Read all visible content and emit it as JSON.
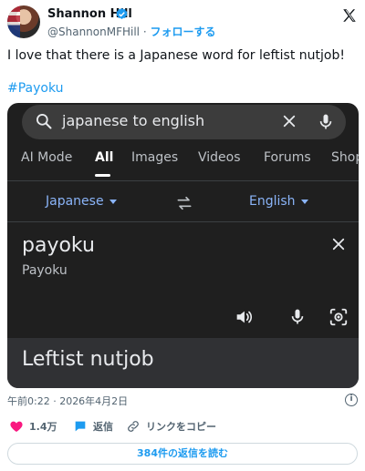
{
  "tweet": {
    "author_name": "Shannon Hill",
    "handle": "@ShannonMFHill",
    "separator": "·",
    "follow_label": "フォローする",
    "text": "I love that there is a Japanese word for leftist nutjob!",
    "hashtag": "#Payoku",
    "timestamp": "午前0:22 · 2026年4月2日",
    "likes_count": "1.4万",
    "reply_label": "返信",
    "copy_link_label": "リンクをコピー",
    "read_replies_label": "384件の返信を読む"
  },
  "media": {
    "search_query": "japanese to english",
    "tabs": [
      {
        "label": "AI Mode"
      },
      {
        "label": "All"
      },
      {
        "label": "Images"
      },
      {
        "label": "Videos"
      },
      {
        "label": "Forums"
      },
      {
        "label": "Shop"
      }
    ],
    "active_tab": "All",
    "source_language": "Japanese",
    "target_language": "English",
    "source_word": "payoku",
    "source_transliteration": "Payoku",
    "translation": "Leftist nutjob"
  },
  "colors": {
    "brand_blue": "#1d9bf0",
    "like_pink": "#f91880",
    "google_dark_bg": "#1f1f1f",
    "google_link_blue": "#8ab4f8"
  },
  "icons": [
    "verified-badge-icon",
    "x-logo-icon",
    "search-icon",
    "clear-icon",
    "microphone-icon",
    "swap-icon",
    "close-icon",
    "speaker-icon",
    "camera-lens-icon",
    "info-icon",
    "heart-icon",
    "reply-icon",
    "link-icon"
  ]
}
